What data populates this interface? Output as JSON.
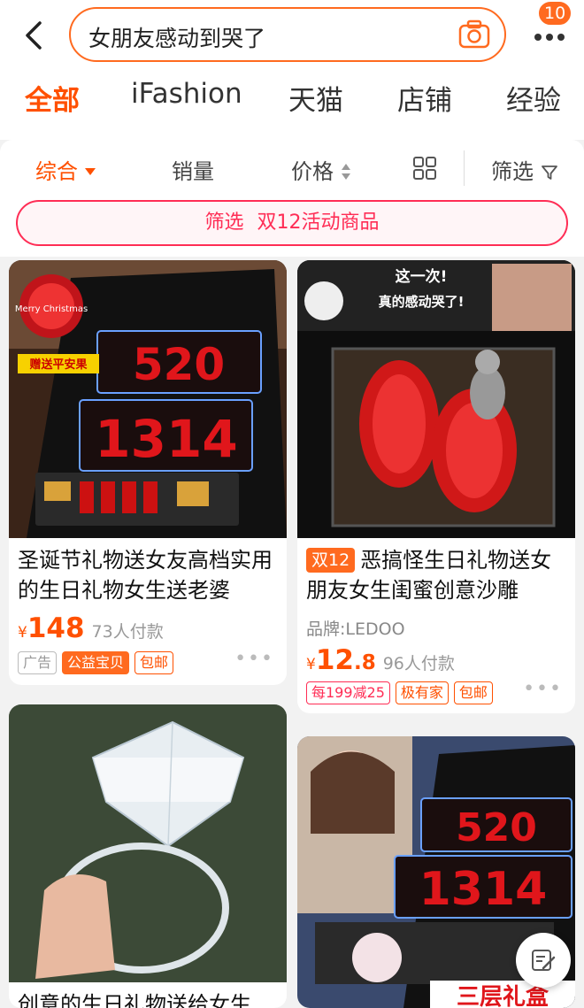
{
  "search": {
    "query": "女朋友感动到哭了",
    "camera_icon": "camera-icon"
  },
  "badge": {
    "count": "10"
  },
  "tabs": [
    {
      "label": "全部",
      "active": true
    },
    {
      "label": "iFashion"
    },
    {
      "label": "天猫"
    },
    {
      "label": "店铺"
    },
    {
      "label": "经验"
    }
  ],
  "sort": {
    "comprehensive": "综合",
    "sales": "销量",
    "price": "价格",
    "filter": "筛选"
  },
  "promo": {
    "prefix": "筛选",
    "label": "双12活动商品"
  },
  "products": [
    {
      "title": "圣诞节礼物送女友高档实用的生日礼物女生送老婆",
      "image_badge": "赠送平安果",
      "image_title": "Merry Christmas",
      "price_int": "148",
      "price_dec": "",
      "yen": "¥",
      "sold": "73人付款",
      "tags": [
        "广告",
        "公益宝贝",
        "包邮"
      ]
    },
    {
      "title_tag": "双12",
      "title": "恶搞怪生日礼物送女朋友女生闺蜜创意沙雕",
      "image_text1": "这一次!",
      "image_text2": "真的感动哭了!",
      "brand": "品牌:LEDOO",
      "price_int": "12",
      "price_dec": ".8",
      "yen": "¥",
      "sold": "96人付款",
      "tags": [
        "每199减25",
        "极有家",
        "包邮"
      ]
    },
    {
      "title": "创意的生日礼物送给女生"
    },
    {
      "image_banner": "三层礼盒"
    }
  ],
  "colors": {
    "accent": "#ff5000",
    "promo": "#ff2d55"
  }
}
